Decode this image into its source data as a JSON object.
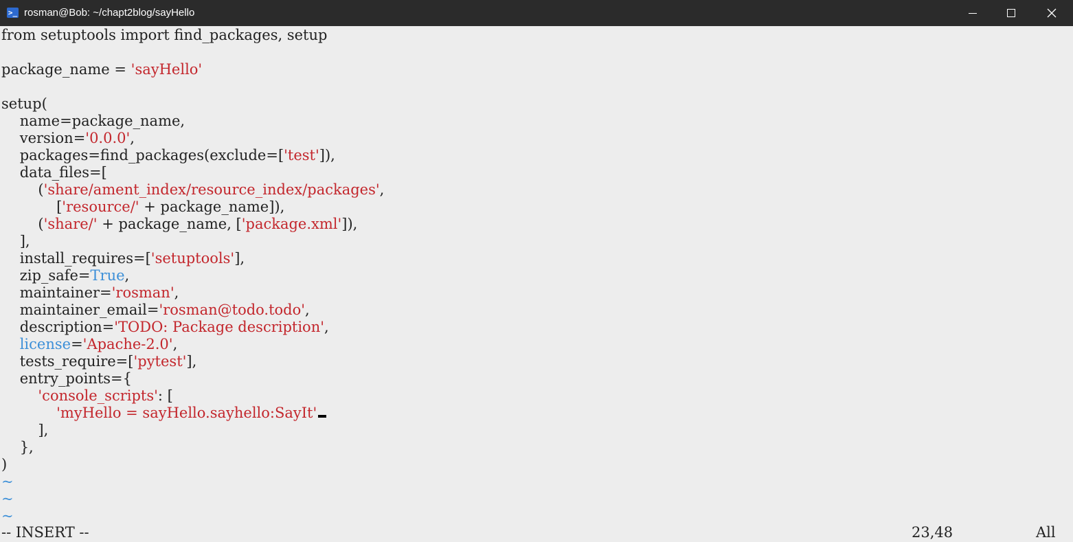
{
  "window": {
    "title": "rosman@Bob: ~/chapt2blog/sayHello",
    "icon": "powershell-icon",
    "controls": {
      "minimize": "minimize-icon",
      "maximize": "maximize-icon",
      "close": "close-icon"
    }
  },
  "code": {
    "l1_a": "from setuptools import find_packages, setup",
    "l3_a": "package_name = ",
    "l3_s": "'sayHello'",
    "l5_a": "setup(",
    "l6_a": "    name=package_name,",
    "l7_a": "    version=",
    "l7_s": "'0.0.0'",
    "l7_b": ",",
    "l8_a": "    packages=find_packages(exclude=[",
    "l8_s": "'test'",
    "l8_b": "]),",
    "l9_a": "    data_files=[",
    "l10_a": "        (",
    "l10_s": "'share/ament_index/resource_index/packages'",
    "l10_b": ",",
    "l11_a": "            [",
    "l11_s": "'resource/'",
    "l11_b": " + package_name]),",
    "l12_a": "        (",
    "l12_s": "'share/'",
    "l12_b": " + package_name, [",
    "l12_s2": "'package.xml'",
    "l12_c": "]),",
    "l13_a": "    ],",
    "l14_a": "    install_requires=[",
    "l14_s": "'setuptools'",
    "l14_b": "],",
    "l15_a": "    zip_safe=",
    "l15_k": "True",
    "l15_b": ",",
    "l16_a": "    maintainer=",
    "l16_s": "'rosman'",
    "l16_b": ",",
    "l17_a": "    maintainer_email=",
    "l17_s": "'rosman@todo.todo'",
    "l17_b": ",",
    "l18_a": "    description=",
    "l18_s": "'TODO: Package description'",
    "l18_b": ",",
    "l19_k": "    license",
    "l19_a": "=",
    "l19_s": "'Apache-2.0'",
    "l19_b": ",",
    "l20_a": "    tests_require=[",
    "l20_s": "'pytest'",
    "l20_b": "],",
    "l21_a": "    entry_points={",
    "l22_a": "        ",
    "l22_s": "'console_scripts'",
    "l22_b": ": [",
    "l23_a": "            ",
    "l23_s": "'myHello = sayHello.sayhello:SayIt'",
    "l24_a": "        ],",
    "l25_a": "    },",
    "l26_a": ")",
    "tilde": "~"
  },
  "statusbar": {
    "mode": "-- INSERT --",
    "position": "23,48",
    "scroll": "All"
  }
}
